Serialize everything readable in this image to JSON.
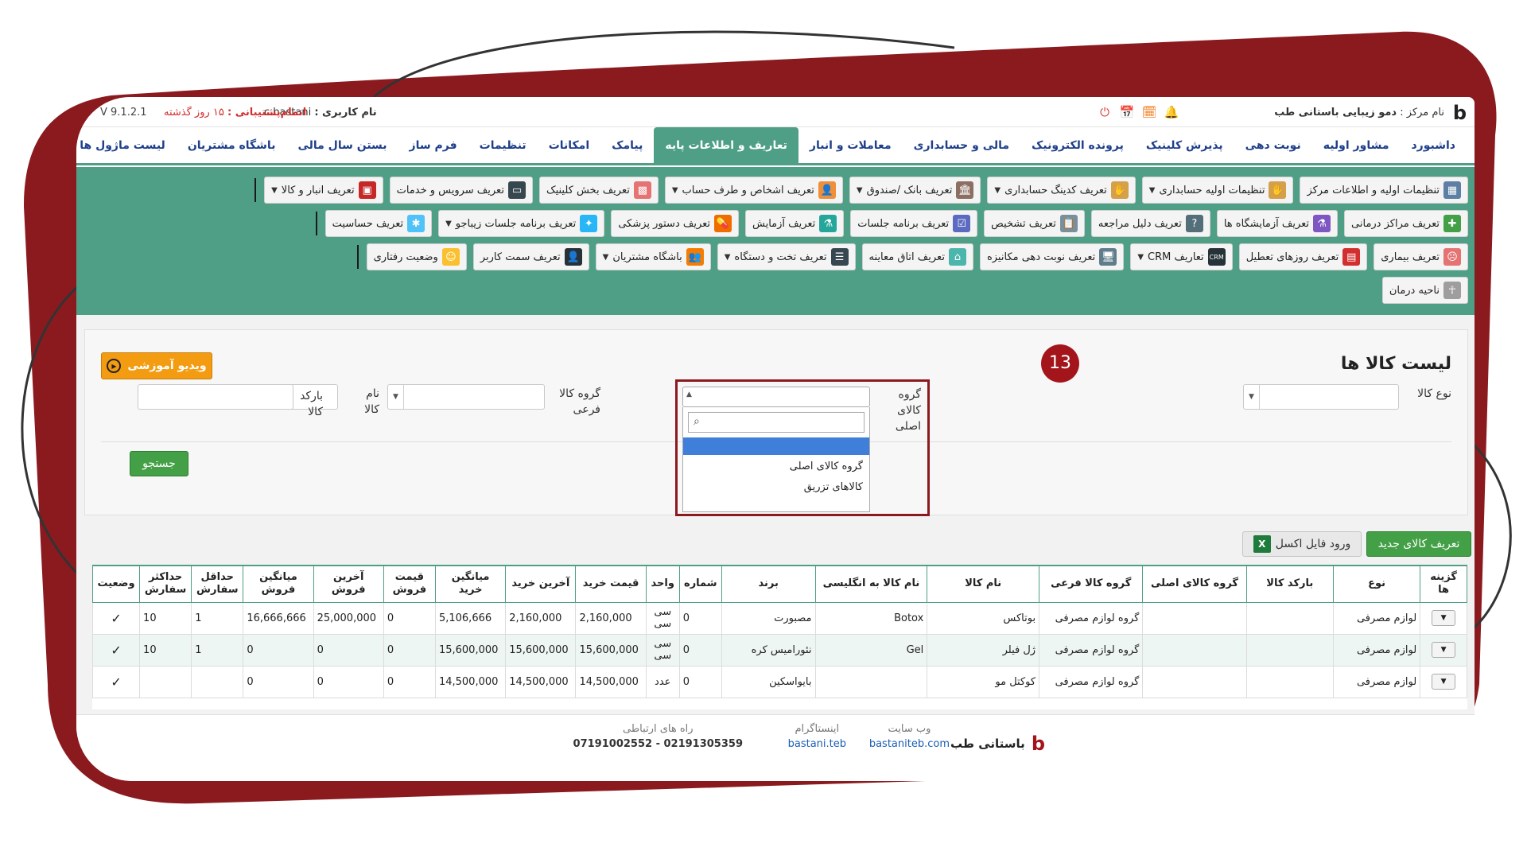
{
  "topbar": {
    "center_label": "نام مرکز :",
    "center_name": "دمو زیبایی باستانی طب",
    "user_label": "نام کاربری :",
    "user_name": "c.bastani",
    "support_label": "اتمام‌پشتیبانی :",
    "support_value": "۱۵ روز گذشته",
    "version": "V 9.1.2.1"
  },
  "menu": [
    "داشبورد",
    "مشاور اولیه",
    "نوبت دهی",
    "پذیرش کلینیک",
    "پرونده الکترونیک",
    "مالی و حسابداری",
    "معاملات و انبار",
    "تعاریف و اطلاعات پایه",
    "پیامک",
    "امکانات",
    "تنظیمات",
    "فرم ساز",
    "بستن سال مالی",
    "باشگاه مشتریان",
    "لیست ماژول ها"
  ],
  "toolbar": {
    "row1": [
      "تنظیمات اولیه و اطلاعات مرکز",
      "تنظیمات اولیه حسابداری",
      "تعریف کدینگ حسابداری",
      "تعریف بانک /صندوق",
      "تعریف اشخاص و طرف حساب",
      "تعریف بخش کلینیک",
      "تعریف سرویس و خدمات",
      "تعریف انبار و کالا"
    ],
    "row2": [
      "تعریف مراکز درمانی",
      "تعریف آزمایشگاه ها",
      "تعریف دلیل مراجعه",
      "تعریف تشخیص",
      "تعریف برنامه جلسات",
      "تعریف آزمایش",
      "تعریف دستور پزشکی",
      "تعریف برنامه جلسات زیباجو",
      "تعریف حساسیت"
    ],
    "row3": [
      "تعریف بیماری",
      "تعریف روزهای تعطیل",
      "تعاریف CRM",
      "تعریف نوبت دهی مکانیزه",
      "تعریف اتاق معاینه",
      "تعریف تخت و دستگاه",
      "باشگاه مشتریان",
      "تعریف سمت کاربر",
      "وضعیت رفتاری"
    ],
    "row4": [
      "ناحیه درمان"
    ]
  },
  "page": {
    "title": "لیست کالا ها",
    "video_label": "ویدیو آموزشی",
    "badge": "13",
    "filters": {
      "type_label": "نوع کالا",
      "main_group_label": "گروه کالای اصلی",
      "sub_group_label": "گروه کالا فرعی",
      "name_label": "نام کالا",
      "barcode_label": "بارکد کالا"
    },
    "search_label": "جستجو",
    "dropdown_options": [
      "گروه کالای اصلی",
      "کالاهای تزریق"
    ],
    "new_item_label": "تعریف کالای جدید",
    "excel_label": "ورود فایل اکسل"
  },
  "table": {
    "headers": [
      "گزینه ها",
      "نوع",
      "بارکد کالا",
      "گروه کالای اصلی",
      "گروه کالا فرعی",
      "نام کالا",
      "نام کالا به انگلیسی",
      "برند",
      "شماره",
      "واحد",
      "قیمت خرید",
      "آخرین خرید",
      "میانگین خرید",
      "قیمت فروش",
      "آخرین فروش",
      "میانگین فروش",
      "حداقل سفارش",
      "حداکثر سفارش",
      "وضعیت"
    ],
    "rows": [
      {
        "type": "لوازم مصرفی",
        "barcode": "",
        "main": "",
        "sub": "گروه لوازم مصرفی",
        "name": "بوتاکس",
        "en": "Botox",
        "brand": "مصبورت",
        "num": "0",
        "unit": "سی سی",
        "buy": "2,160,000",
        "last_buy": "2,160,000",
        "avg_buy": "5,106,666",
        "sell": "0",
        "last_sell": "25,000,000",
        "avg_sell": "16,666,666",
        "min": "1",
        "max": "10",
        "status": "✓"
      },
      {
        "type": "لوازم مصرفی",
        "barcode": "",
        "main": "",
        "sub": "گروه لوازم مصرفی",
        "name": "ژل فیلر",
        "en": "Gel",
        "brand": "نئورامیس کره",
        "num": "0",
        "unit": "سی سی",
        "buy": "15,600,000",
        "last_buy": "15,600,000",
        "avg_buy": "15,600,000",
        "sell": "0",
        "last_sell": "0",
        "avg_sell": "0",
        "min": "1",
        "max": "10",
        "status": "✓"
      },
      {
        "type": "لوازم مصرفی",
        "barcode": "",
        "main": "",
        "sub": "گروه لوازم مصرفی",
        "name": "کوکتل مو",
        "en": "",
        "brand": "بایواسکین",
        "num": "0",
        "unit": "عدد",
        "buy": "14,500,000",
        "last_buy": "14,500,000",
        "avg_buy": "14,500,000",
        "sell": "0",
        "last_sell": "0",
        "avg_sell": "0",
        "min": "",
        "max": "",
        "status": "✓"
      }
    ]
  },
  "footer": {
    "brand": "باستانی طب",
    "website_title": "وب سایت",
    "website": "bastaniteb.com",
    "instagram_title": "اینستاگرام",
    "instagram": "bastani.teb",
    "contact_title": "راه های ارتباطی",
    "contact": "07191002552 - 02191305359"
  },
  "colors": {
    "accent": "#4e9f85",
    "frame": "#8b1a1f",
    "badge": "#a3151b",
    "nav_text": "#1e3f8a"
  }
}
